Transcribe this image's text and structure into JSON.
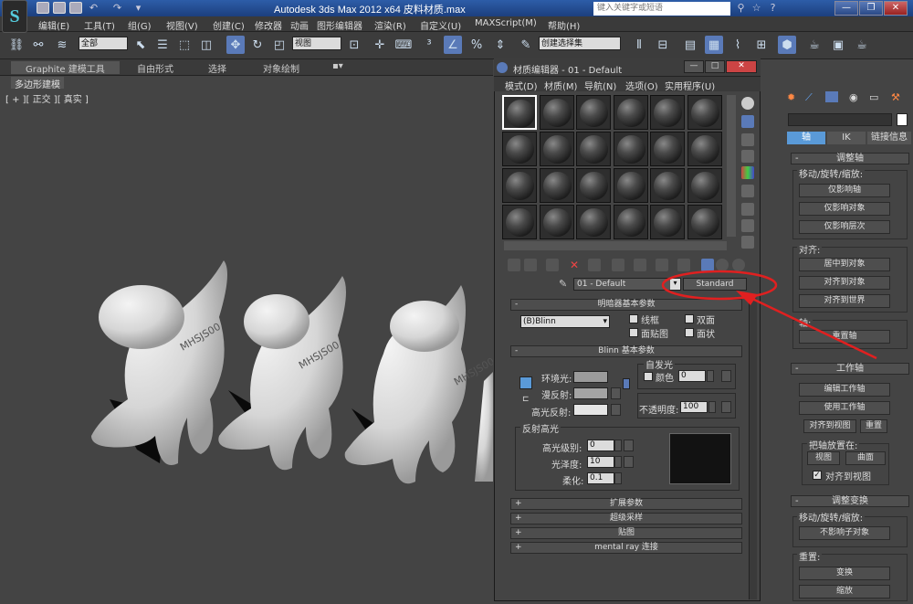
{
  "window": {
    "title": "Autodesk 3ds Max  2012 x64    皮料材质.max",
    "search_placeholder": "键入关键字或短语",
    "controls": [
      "—",
      "❐",
      "✕"
    ]
  },
  "menu": [
    "编辑(E)",
    "工具(T)",
    "组(G)",
    "视图(V)",
    "创建(C)",
    "修改器",
    "动画",
    "图形编辑器",
    "渲染(R)",
    "自定义(U)",
    "MAXScript(M)",
    "帮助(H)"
  ],
  "toolbar": {
    "selection_filter": "全部",
    "ref_coord": "视图",
    "named_selection": "创建选择集"
  },
  "ribbon": {
    "tabs": [
      "Graphite 建模工具",
      "自由形式",
      "选择",
      "对象绘制"
    ],
    "sub": "多边形建模"
  },
  "viewport": {
    "label": "[ + ][ 正交 ][ 真实 ]",
    "model_text": "MHSJS00"
  },
  "material_editor": {
    "title": "材质编辑器 - 01 - Default",
    "menu": [
      "模式(D)",
      "材质(M)",
      "导航(N)",
      "选项(O)",
      "实用程序(U)"
    ],
    "material_name": "01 - Default",
    "material_type": "Standard",
    "shader_rollout": {
      "title": "明暗器基本参数",
      "shader": "(B)Blinn",
      "wire": "线框",
      "two_sided": "双面",
      "face_map": "面贴图",
      "faceted": "面状"
    },
    "blinn_rollout": {
      "title": "Blinn 基本参数",
      "ambient": "环境光:",
      "diffuse": "漫反射:",
      "specular": "高光反射:",
      "self_illum": "自发光",
      "color_label": "颜色",
      "self_illum_value": "0",
      "opacity_label": "不透明度:",
      "opacity_value": "100"
    },
    "spec_highlights": {
      "title": "反射高光",
      "level_label": "高光级别:",
      "level_value": "0",
      "gloss_label": "光泽度:",
      "gloss_value": "10",
      "soften_label": "柔化:",
      "soften_value": "0.1"
    },
    "collapsed_rollouts": [
      "扩展参数",
      "超级采样",
      "贴图",
      "mental ray 连接"
    ],
    "colors": {
      "ambient": "#9b9b9b",
      "diffuse": "#a4a4a4",
      "specular": "#e6e6e6",
      "highlight_curve": "#121212"
    }
  },
  "command_panel": {
    "tabs": [
      "轴",
      "IK",
      "链接信息"
    ],
    "adjust_pivot": {
      "title": "调整轴",
      "group1": "移动/旋转/缩放:",
      "btn1": "仅影响轴",
      "btn2": "仅影响对象",
      "btn3": "仅影响层次",
      "group2": "对齐:",
      "btn4": "居中到对象",
      "btn5": "对齐到对象",
      "btn6": "对齐到世界",
      "group3": "轴:",
      "btn7": "重置轴"
    },
    "working_pivot": {
      "title": "工作轴",
      "btn1": "编辑工作轴",
      "btn2": "使用工作轴",
      "btn3": "对齐到视图",
      "btn4": "重置",
      "group": "把轴放置在:",
      "btn5": "视图",
      "btn6": "曲面",
      "check": "对齐到视图"
    },
    "adjust_transform": {
      "title": "调整变换",
      "group1": "移动/旋转/缩放:",
      "btn1": "不影响子对象",
      "group2": "重置:",
      "btn2": "变换",
      "btn3": "缩放"
    }
  }
}
